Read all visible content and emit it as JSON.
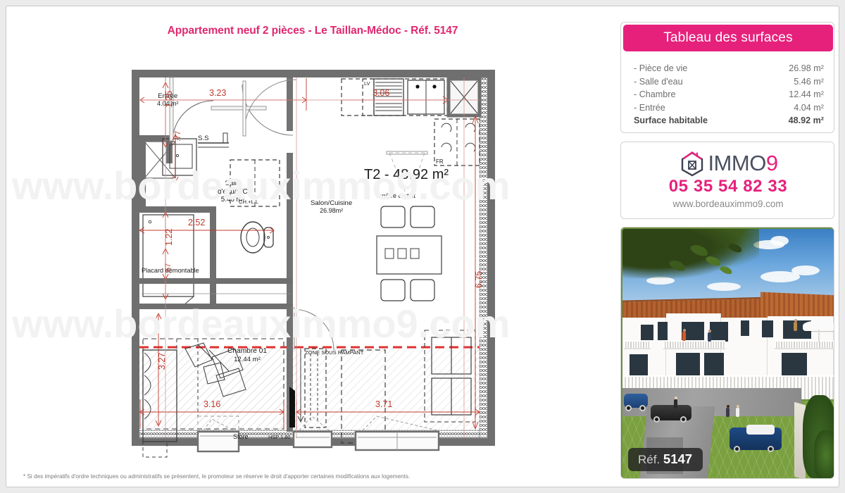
{
  "document": {
    "title": "Appartement neuf 2 pièces - Le Taillan-Médoc - Réf. 5147",
    "footer_note": "* Si des impératifs d'ordre techniques ou administratifs se présentent, le promoteur se réserve le droit d'apporter certaines modifications aux logements.",
    "watermark": "www.bordeauximmo9.com",
    "accent_color": "#e6217c",
    "dimension_color": "#c0392b"
  },
  "surfaces": {
    "header": "Tableau des surfaces",
    "rows": [
      {
        "label": "- Pièce de vie",
        "value": "26.98 m²"
      },
      {
        "label": "- Salle d'eau",
        "value": "5.46 m²"
      },
      {
        "label": "- Chambre",
        "value": "12.44 m²"
      },
      {
        "label": "- Entrée",
        "value": "4.04 m²"
      }
    ],
    "total": {
      "label": "Surface habitable",
      "value": "48.92 m²"
    }
  },
  "agency": {
    "logo_text": "IMMO",
    "logo_accent": "9",
    "phone": "05 35 54 82 33",
    "website": "www.bordeauximmo9.com"
  },
  "photo": {
    "ref_prefix": "Réf.",
    "ref_number": "5147"
  },
  "plan": {
    "type_label": "T2 - 48.92 m²",
    "rooms": [
      {
        "name": "Entrée",
        "area": "4.04 m²"
      },
      {
        "name": "Salle\nd'eau/WC",
        "area": "5.46 m²"
      },
      {
        "name": "Salon/Cuisine",
        "area": "26.98m²"
      },
      {
        "name": "Chambre 01",
        "area": "12.44 m²"
      }
    ],
    "room_entree_name": "Entrée",
    "room_entree_area": "4.04 m²",
    "room_bath_name_1": "Salle",
    "room_bath_name_2": "d'eau/WC",
    "room_bath_area": "5.46 m²",
    "room_living_name": "Salon/Cuisine",
    "room_living_area": "26.98m²",
    "room_bed_name": "Chambre 01",
    "room_bed_area": "12.44 m²",
    "annotations": {
      "roof_window": "fenêtre de toit",
      "closet": "Placard démontable",
      "sous_rampant": "ZONE SOUS RAMPANT",
      "store": "Store",
      "hsp": "HSP 1.80",
      "ss": "S.S",
      "ch_ll": "CH.+L.L",
      "lv": "LV",
      "fr": "FR"
    },
    "dimensions": {
      "entree_width": "3.23",
      "entree_height": "1.25",
      "kitchen_width": "3.06",
      "bath_width": "2.52",
      "bath_height": "1.22",
      "sink_small": ".77",
      "closet_depth": ".67",
      "right_height": "6.75",
      "bed_height": "3.27",
      "bed_width": "3.16",
      "living_width": "3.71"
    }
  }
}
